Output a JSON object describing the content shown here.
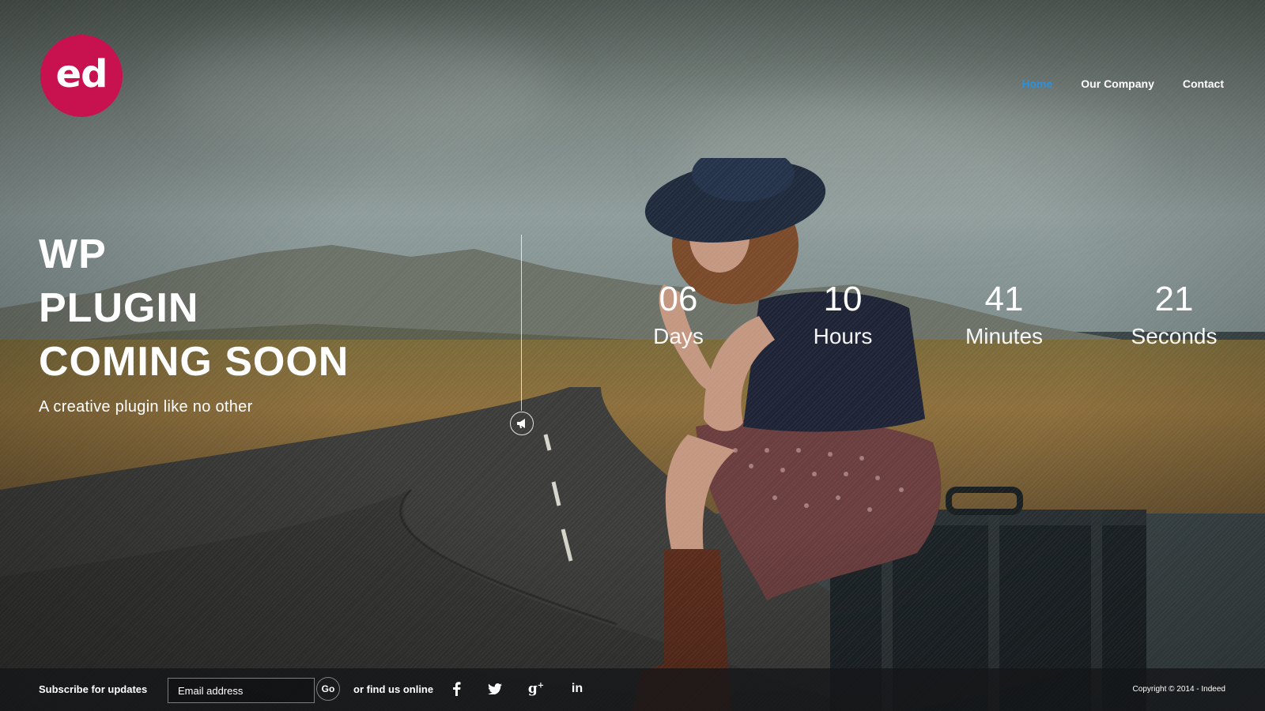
{
  "logo": {
    "text": "ed"
  },
  "nav": {
    "items": [
      {
        "label": "Home",
        "active": true
      },
      {
        "label": "Our Company",
        "active": false
      },
      {
        "label": "Contact",
        "active": false
      }
    ]
  },
  "hero": {
    "lines": [
      "WP",
      "PLUGIN",
      "COMING SOON"
    ],
    "subtitle": "A creative plugin like no other"
  },
  "countdown": [
    {
      "value": "06",
      "label": "Days"
    },
    {
      "value": "10",
      "label": "Hours"
    },
    {
      "value": "41",
      "label": "Minutes"
    },
    {
      "value": "21",
      "label": "Seconds"
    }
  ],
  "footer": {
    "subscribe_label": "Subscribe for updates",
    "email_placeholder": "Email address",
    "go_label": "Go",
    "find_us_label": "or find us online",
    "social": [
      "facebook-icon",
      "twitter-icon",
      "google-plus-icon",
      "linkedin-icon"
    ],
    "copyright": "Copyright © 2014 - Indeed"
  },
  "colors": {
    "brand": "#c8124f",
    "nav_active": "#2f8fd8",
    "text": "#ffffff"
  }
}
